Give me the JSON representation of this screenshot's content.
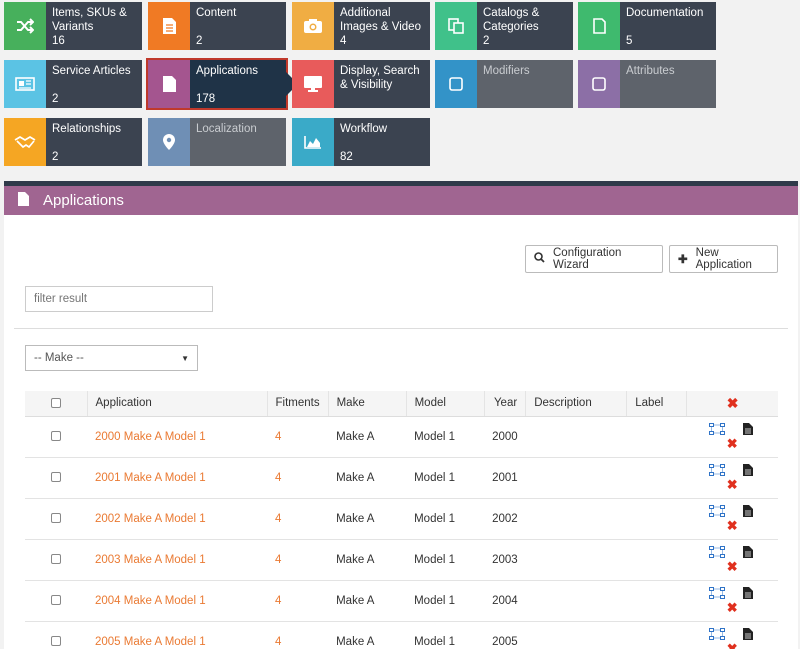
{
  "tiles": [
    {
      "label": "Items, SKUs & Variants",
      "count": "16",
      "color": "#47b05c",
      "icon": "shuffle-icon"
    },
    {
      "label": "Content",
      "count": "2",
      "color": "#f07a24",
      "icon": "document-lines-icon"
    },
    {
      "label": "Additional Images & Video",
      "count": "4",
      "color": "#f0ad43",
      "icon": "camera-icon"
    },
    {
      "label": "Catalogs & Categories",
      "count": "2",
      "color": "#40c18a",
      "icon": "copy-icon"
    },
    {
      "label": "Documentation",
      "count": "5",
      "color": "#3fba6e",
      "icon": "file-icon"
    },
    {
      "label": "Service Articles",
      "count": "2",
      "color": "#5bc3e4",
      "icon": "newspaper-icon"
    },
    {
      "label": "Applications",
      "count": "178",
      "color": "#a4558f",
      "icon": "file-icon"
    },
    {
      "label": "Display, Search & Visibility",
      "count": "",
      "color": "#e85b5b",
      "icon": "monitor-icon"
    },
    {
      "label": "Modifiers",
      "count": "",
      "color": "#3393c8",
      "icon": "square-icon"
    },
    {
      "label": "Attributes",
      "count": "",
      "color": "#8c6fa6",
      "icon": "square-icon"
    },
    {
      "label": "Relationships",
      "count": "2",
      "color": "#f5a623",
      "icon": "handshake-icon"
    },
    {
      "label": "Localization",
      "count": "",
      "color": "#6f8fb5",
      "icon": "map-pin-icon"
    },
    {
      "label": "Workflow",
      "count": "82",
      "color": "#3aaac8",
      "icon": "area-chart-icon"
    }
  ],
  "panel": {
    "title": "Applications",
    "wizard_label": "Configuration Wizard",
    "new_label": "New Application",
    "filter_placeholder": "filter result",
    "make_select": "-- Make --"
  },
  "table": {
    "headers": {
      "application": "Application",
      "fitments": "Fitments",
      "make": "Make",
      "model": "Model",
      "year": "Year",
      "description": "Description",
      "label": "Label"
    },
    "rows": [
      {
        "application": "2000 Make A Model 1",
        "fitments": "4",
        "make": "Make A",
        "model": "Model 1",
        "year": "2000",
        "description": "",
        "label": ""
      },
      {
        "application": "2001 Make A Model 1",
        "fitments": "4",
        "make": "Make A",
        "model": "Model 1",
        "year": "2001",
        "description": "",
        "label": ""
      },
      {
        "application": "2002 Make A Model 1",
        "fitments": "4",
        "make": "Make A",
        "model": "Model 1",
        "year": "2002",
        "description": "",
        "label": ""
      },
      {
        "application": "2003 Make A Model 1",
        "fitments": "4",
        "make": "Make A",
        "model": "Model 1",
        "year": "2003",
        "description": "",
        "label": ""
      },
      {
        "application": "2004 Make A Model 1",
        "fitments": "4",
        "make": "Make A",
        "model": "Model 1",
        "year": "2004",
        "description": "",
        "label": ""
      },
      {
        "application": "2005 Make A Model 1",
        "fitments": "4",
        "make": "Make A",
        "model": "Model 1",
        "year": "2005",
        "description": "",
        "label": ""
      }
    ]
  },
  "colors": {
    "accent": "#a06591",
    "link": "#ea7a33",
    "delete": "#e0301e"
  }
}
